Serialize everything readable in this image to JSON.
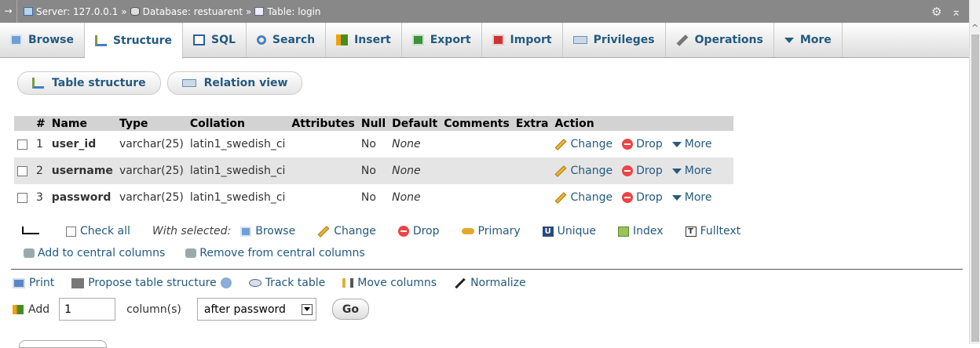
{
  "breadcrumb": {
    "server": "Server: 127.0.0.1",
    "database": "Database: restuarent",
    "table": "Table: login",
    "sep": "»"
  },
  "tabs": [
    {
      "label": "Browse",
      "icon": "browse-icon"
    },
    {
      "label": "Structure",
      "icon": "structure-icon",
      "active": true
    },
    {
      "label": "SQL",
      "icon": "sql-icon"
    },
    {
      "label": "Search",
      "icon": "search-icon"
    },
    {
      "label": "Insert",
      "icon": "insert-icon"
    },
    {
      "label": "Export",
      "icon": "export-icon"
    },
    {
      "label": "Import",
      "icon": "import-icon"
    },
    {
      "label": "Privileges",
      "icon": "privileges-icon"
    },
    {
      "label": "Operations",
      "icon": "operations-icon"
    },
    {
      "label": "More",
      "icon": "dropdown-icon"
    }
  ],
  "subnav": {
    "table_structure": "Table structure",
    "relation_view": "Relation view"
  },
  "table": {
    "headers": [
      "#",
      "Name",
      "Type",
      "Collation",
      "Attributes",
      "Null",
      "Default",
      "Comments",
      "Extra",
      "Action"
    ],
    "rows": [
      {
        "num": "1",
        "name": "user_id",
        "type": "varchar(25)",
        "collation": "latin1_swedish_ci",
        "attributes": "",
        "null": "No",
        "default": "None",
        "comments": "",
        "extra": ""
      },
      {
        "num": "2",
        "name": "username",
        "type": "varchar(25)",
        "collation": "latin1_swedish_ci",
        "attributes": "",
        "null": "No",
        "default": "None",
        "comments": "",
        "extra": ""
      },
      {
        "num": "3",
        "name": "password",
        "type": "varchar(25)",
        "collation": "latin1_swedish_ci",
        "attributes": "",
        "null": "No",
        "default": "None",
        "comments": "",
        "extra": ""
      }
    ],
    "actions": {
      "change": "Change",
      "drop": "Drop",
      "more": "More"
    }
  },
  "with_selected": {
    "check_all": "Check all",
    "label": "With selected:",
    "browse": "Browse",
    "change": "Change",
    "drop": "Drop",
    "primary": "Primary",
    "unique": "Unique",
    "index": "Index",
    "fulltext": "Fulltext",
    "unique_glyph": "U",
    "fulltext_glyph": "T"
  },
  "central": {
    "add": "Add to central columns",
    "remove": "Remove from central columns"
  },
  "tools": {
    "print": "Print",
    "propose": "Propose table structure",
    "track": "Track table",
    "move": "Move columns",
    "normalize": "Normalize"
  },
  "add_columns": {
    "label": "Add",
    "count": "1",
    "unit": "column(s)",
    "position": "after password",
    "go": "Go"
  }
}
